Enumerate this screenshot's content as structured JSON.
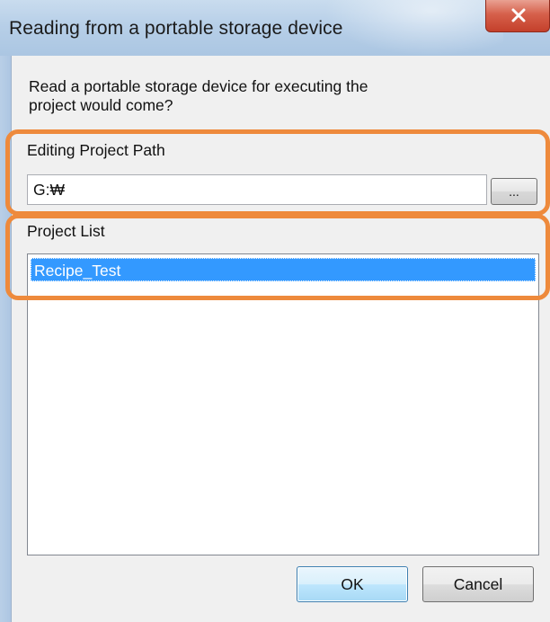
{
  "window": {
    "title": "Reading from a portable storage device"
  },
  "message": "Read a portable storage device for executing the project would come?",
  "editing_path": {
    "label": "Editing Project Path",
    "value": "G:₩",
    "browse_label": "..."
  },
  "project_list": {
    "label": "Project List",
    "items": [
      "Recipe_Test"
    ],
    "selected_index": 0
  },
  "buttons": {
    "ok": "OK",
    "cancel": "Cancel"
  },
  "colors": {
    "highlight": "#ee8a3c",
    "selection": "#3399ff",
    "close_button": "#d6604b"
  },
  "icons": {
    "close": "close-icon"
  }
}
